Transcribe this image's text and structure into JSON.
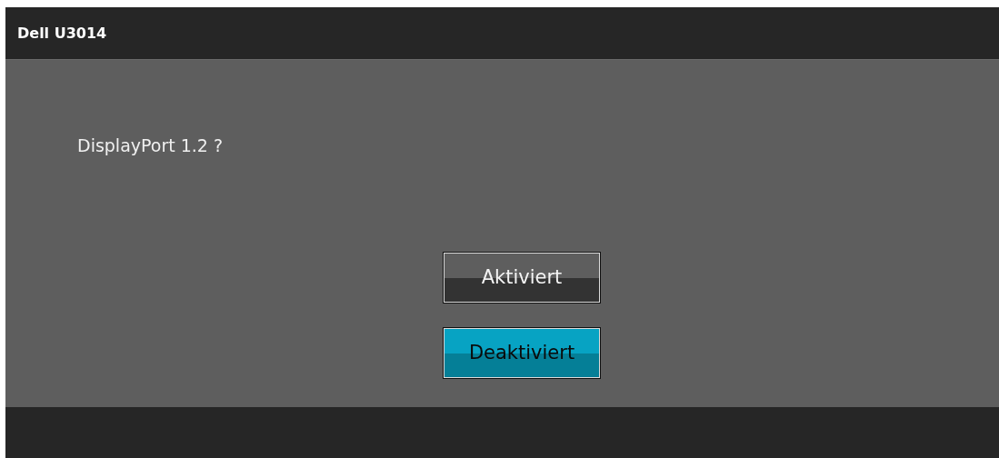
{
  "header": {
    "title": "Dell U3014"
  },
  "prompt": "DisplayPort 1.2 ?",
  "options": [
    {
      "label": "Aktiviert",
      "selected": false
    },
    {
      "label": "Deaktiviert",
      "selected": true
    }
  ]
}
